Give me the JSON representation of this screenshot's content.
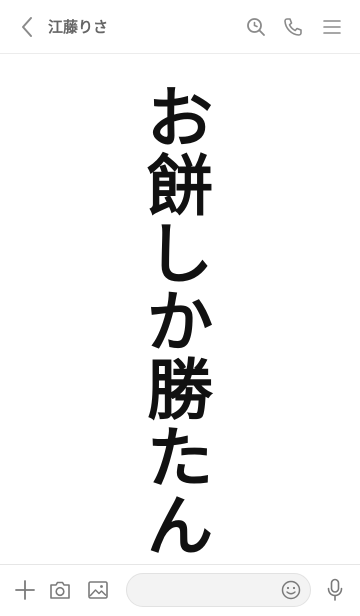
{
  "header": {
    "title": "江藤りさ",
    "icons": {
      "back": "chevron-left-icon",
      "search": "search-icon",
      "phone": "phone-icon",
      "menu": "menu-icon"
    }
  },
  "message": {
    "characters": [
      "お",
      "餅",
      "し",
      "か",
      "勝",
      "た",
      "ん"
    ]
  },
  "footer": {
    "input_placeholder": "",
    "icons": {
      "plus": "plus-icon",
      "camera": "camera-icon",
      "image": "image-icon",
      "emoji": "emoji-icon",
      "mic": "microphone-icon"
    }
  },
  "colors": {
    "header_text": "#666666",
    "icon": "#8a8a8a",
    "text": "#111111",
    "input_bg": "#f3f3f3"
  }
}
